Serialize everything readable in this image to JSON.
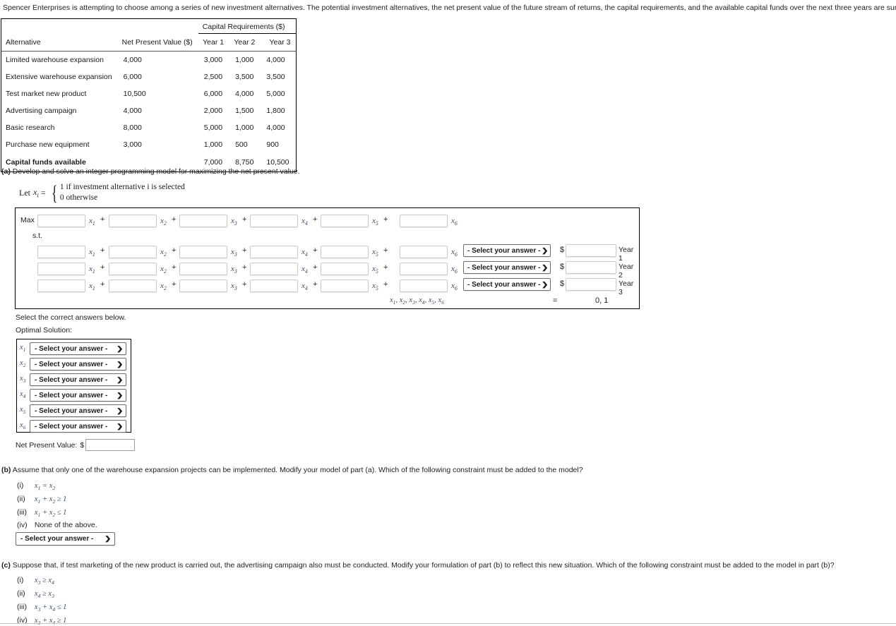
{
  "intro": {
    "paragraph": "Spencer Enterprises is attempting to choose among a series of new investment alternatives. The potential investment alternatives, the net present value of the future stream of returns, the capital requirements, and the available capital funds over the next three years are summ"
  },
  "table": {
    "group_header": "Capital Requirements ($)",
    "columns": [
      "Alternative",
      "Net Present Value ($)",
      "Year 1",
      "Year 2",
      "Year 3"
    ],
    "rows": [
      {
        "alternative": "Limited warehouse expansion",
        "npv": "4,000",
        "year1": "3,000",
        "year2": "1,000",
        "year3": "4,000"
      },
      {
        "alternative": "Extensive warehouse expansion",
        "npv": "6,000",
        "year1": "2,500",
        "year2": "3,500",
        "year3": "3,500"
      },
      {
        "alternative": "Test market new product",
        "npv": "10,500",
        "year1": "6,000",
        "year2": "4,000",
        "year3": "5,000"
      },
      {
        "alternative": "Advertising campaign",
        "npv": "4,000",
        "year1": "2,000",
        "year2": "1,500",
        "year3": "1,800"
      },
      {
        "alternative": "Basic research",
        "npv": "8,000",
        "year1": "5,000",
        "year2": "1,000",
        "year3": "4,000"
      },
      {
        "alternative": "Purchase new equipment",
        "npv": "3,000",
        "year1": "1,000",
        "year2": "500",
        "year3": "900"
      }
    ],
    "total_row": {
      "alternative": "Capital funds available",
      "npv": "",
      "year1": "7,000",
      "year2": "8,750",
      "year3": "10,500"
    }
  },
  "part_a": {
    "label": "(a)",
    "question": "Develop and solve an integer programming model for maximizing the net present value.",
    "let_lead": "Let",
    "let_var": "x",
    "let_sub": "i",
    "let_eq": "=",
    "case_1": "1 if investment alternative i is selected",
    "case_2": "0 otherwise",
    "model": {
      "max_label": "Max",
      "st_label": "s.t.",
      "plus": "+",
      "variables": [
        "x1",
        "x2",
        "x3",
        "x4",
        "x5",
        "x6"
      ],
      "var_bases": [
        "x",
        "x",
        "x",
        "x",
        "x",
        "x"
      ],
      "var_subs": [
        "1",
        "2",
        "3",
        "4",
        "5",
        "6"
      ],
      "select_placeholder": "- Select your answer -",
      "caret": "❯",
      "dollar": "$",
      "year_labels": [
        "Year 1",
        "Year 2",
        "Year 3"
      ],
      "binary_vars": "x1, x2, x3, x4, x5, x6",
      "binary_eq": "=",
      "binary_values": "0, 1"
    },
    "select_correct": "Select the correct answers below.",
    "optimal_solution_label": "Optimal Solution:",
    "optimal_rows": [
      {
        "var_base": "x",
        "var_sub": "1",
        "value": "- Select your answer -"
      },
      {
        "var_base": "x",
        "var_sub": "2",
        "value": "- Select your answer -"
      },
      {
        "var_base": "x",
        "var_sub": "3",
        "value": "- Select your answer -"
      },
      {
        "var_base": "x",
        "var_sub": "4",
        "value": "- Select your answer -"
      },
      {
        "var_base": "x",
        "var_sub": "5",
        "value": "- Select your answer -"
      },
      {
        "var_base": "x",
        "var_sub": "6",
        "value": "- Select your answer -"
      }
    ],
    "npv_label": "Net Present Value:",
    "npv_dollar": "$",
    "npv_value": ""
  },
  "part_b": {
    "label": "(b)",
    "question": "Assume that only one of the warehouse expansion projects can be implemented. Modify your model of part (a). Which of the following constraint must be added to the model?",
    "choices": [
      {
        "mark": "(i)",
        "text": "x1 = x2"
      },
      {
        "mark": "(ii)",
        "text": "x1 + x2 ≥ 1"
      },
      {
        "mark": "(iii)",
        "text": "x1 + x2 ≤ 1"
      },
      {
        "mark": "(iv)",
        "text": "None of the above."
      }
    ],
    "select_placeholder": "- Select your answer -",
    "caret": "❯"
  },
  "part_c": {
    "label": "(c)",
    "question": "Suppose that, if test marketing of the new product is carried out, the advertising campaign also must be conducted. Modify your formulation of part (b) to reflect this new situation. Which of the following constraint must be added to the model in part (b)?",
    "choices": [
      {
        "mark": "(i)",
        "text": "x3 ≥ x4"
      },
      {
        "mark": "(ii)",
        "text": "x4 ≥ x3"
      },
      {
        "mark": "(iii)",
        "text": "x3 + x4 ≤ 1"
      },
      {
        "mark": "(iv)",
        "text": "x3 + x4 ≥ 1"
      }
    ]
  },
  "colors": {
    "variable": "#3b4a6b",
    "text": "#1a1a1a",
    "border": "#000000",
    "input_border": "#c9c9c9",
    "select_border": "#6d6d6d"
  }
}
